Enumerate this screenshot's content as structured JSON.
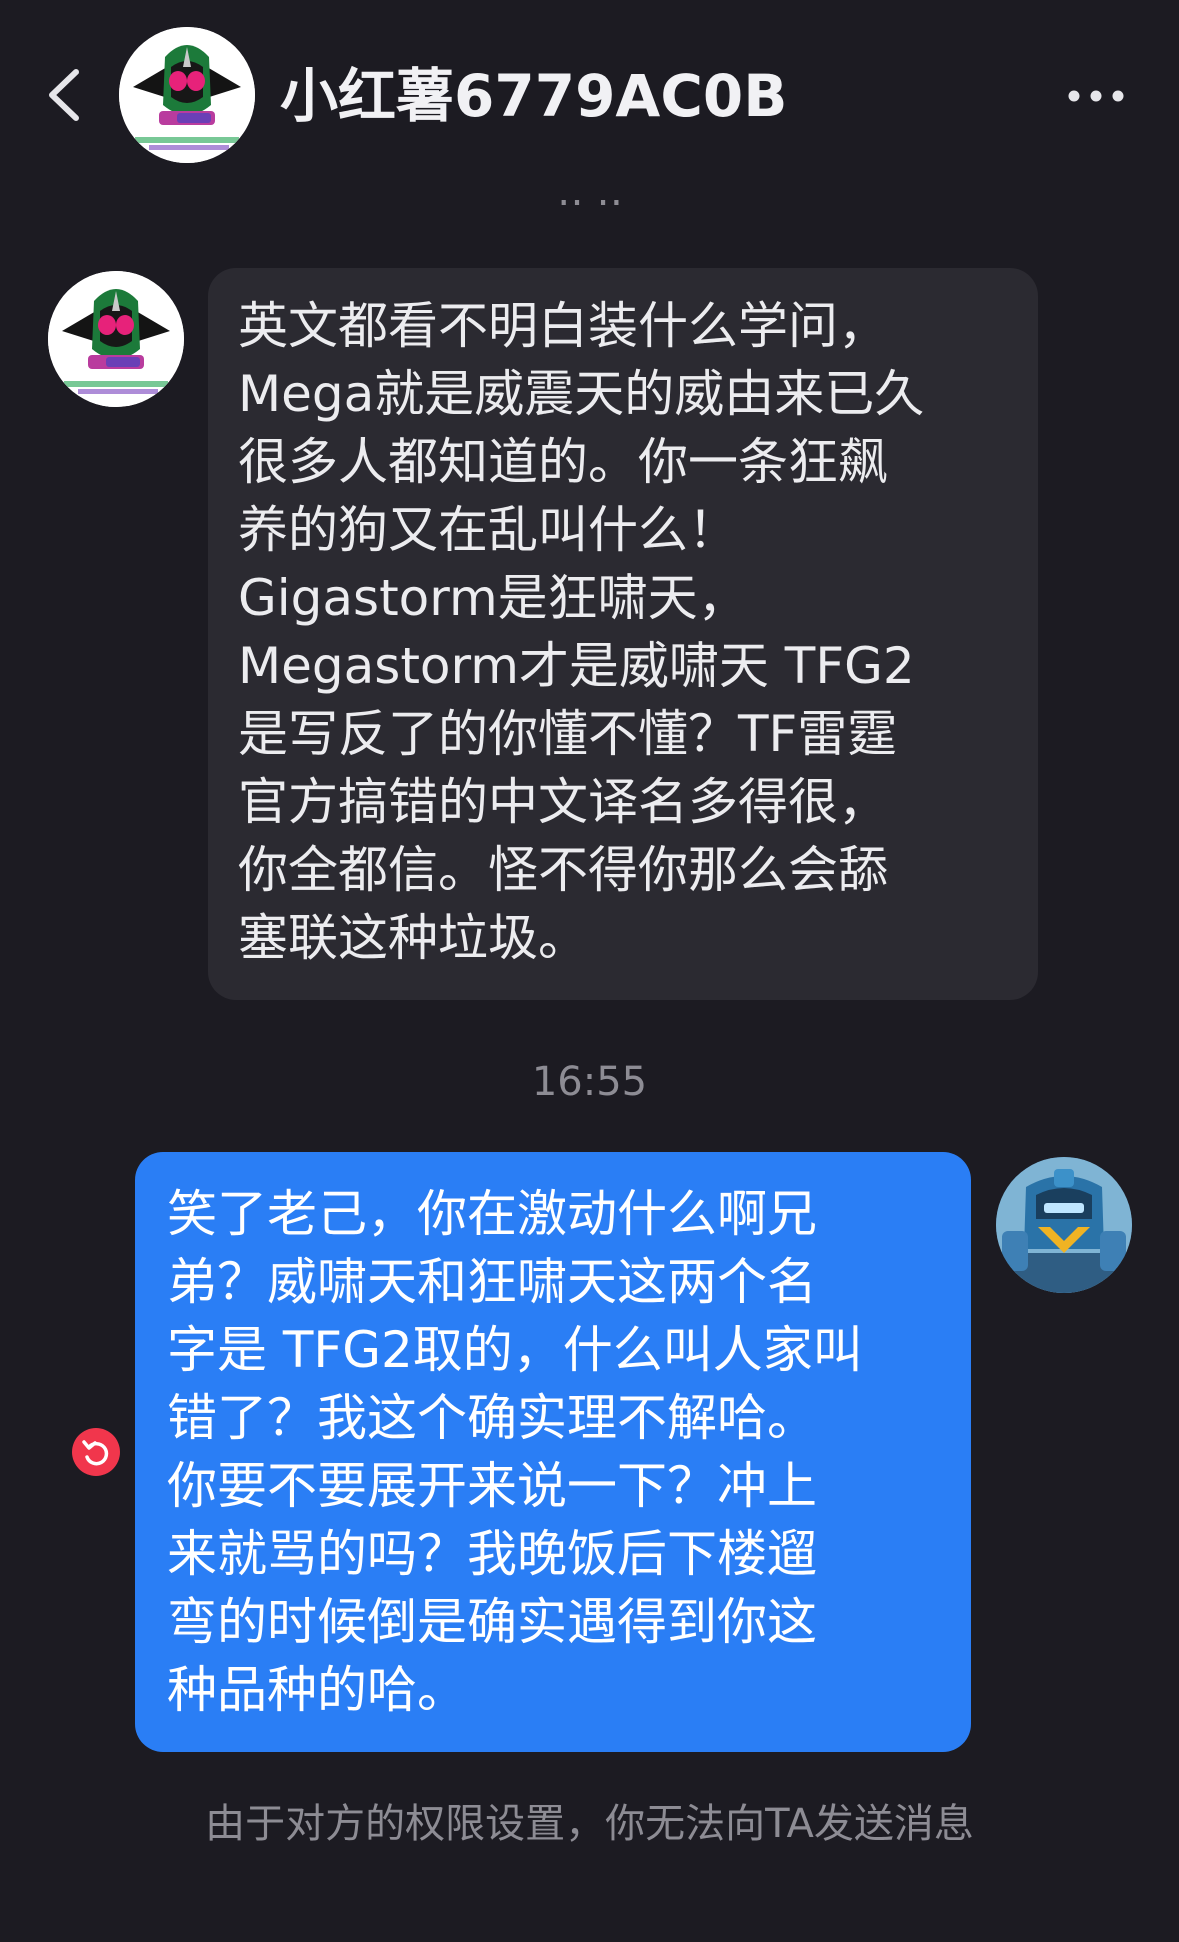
{
  "header": {
    "title": "小红薯6779AC0B",
    "back_icon": "chevron-left-icon",
    "more_icon": "ellipsis-icon"
  },
  "messages": {
    "incoming": {
      "text": "英文都看不明白装什么学问，\nMega就是威震天的威由来已久\n很多人都知道的。你一条狂飙\n养的狗又在乱叫什么！\nGigastorm是狂啸天，\nMegastorm才是威啸天 TFG2\n是写反了的你懂不懂？TF雷霆\n官方搞错的中文译名多得很，\n你全都信。怪不得你那么会舔\n塞联这种垃圾。"
    },
    "timestamp": "16:55",
    "outgoing": {
      "text": "笑了老己，你在激动什么啊兄\n弟？威啸天和狂啸天这两个名\n字是 TFG2取的，什么叫人家叫\n错了？我这个确实理不解哈。\n你要不要展开来说一下？冲上\n来就骂的吗？我晚饭后下楼遛\n弯的时候倒是确实遇得到你这\n种品种的哈。",
      "status_icon": "resend-icon"
    }
  },
  "notice": "由于对方的权限设置，你无法向TA发送消息",
  "colors": {
    "background": "#1c1b22",
    "incoming_bubble": "#2b2a31",
    "outgoing_bubble": "#2a7ef5",
    "error_badge": "#f1364c",
    "muted_text": "#8d8c94"
  }
}
